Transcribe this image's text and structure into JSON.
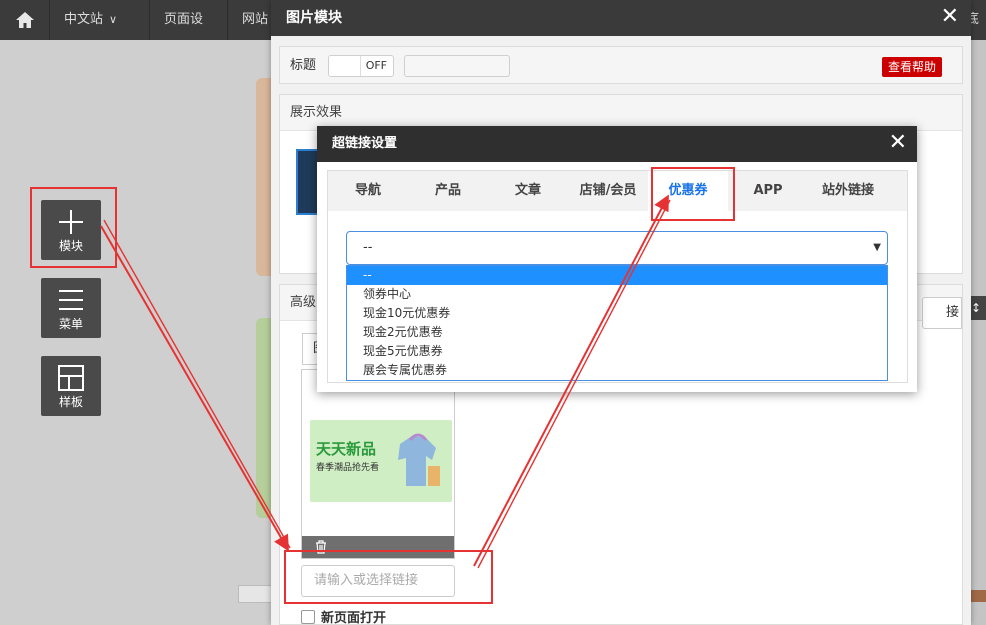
{
  "topbar": {
    "home_icon": "home-icon",
    "nav": [
      {
        "label": "中文站"
      },
      {
        "label": "页面设置"
      },
      {
        "label": "网站"
      }
    ],
    "right_fragment": "底"
  },
  "left_tools": [
    {
      "label": "模块",
      "icon": "plus-icon"
    },
    {
      "label": "菜单",
      "icon": "menu-icon"
    },
    {
      "label": "样板",
      "icon": "template-icon"
    }
  ],
  "picture_dialog": {
    "title": "图片模块",
    "title_row": {
      "label": "标题",
      "toggle_text": "OFF",
      "help_button": "查看帮助"
    },
    "display_section": {
      "label": "展示效果"
    },
    "advanced_section": {
      "label": "高级",
      "tab_stub": "图"
    },
    "promo": {
      "title": "天天新品",
      "subtitle": "春季潮品抢先看"
    },
    "link_input": {
      "placeholder": "请输入或选择链接"
    },
    "new_page_checkbox": "新页面打开",
    "right_button_fragment": "接"
  },
  "link_dialog": {
    "title": "超链接设置",
    "tabs": [
      {
        "label": "导航"
      },
      {
        "label": "产品"
      },
      {
        "label": "文章"
      },
      {
        "label": "店铺/会员"
      },
      {
        "label": "优惠券",
        "active": true
      },
      {
        "label": "APP"
      },
      {
        "label": "站外链接"
      }
    ],
    "select": {
      "value": "--",
      "options": [
        "--",
        "领券中心",
        "现金10元优惠券",
        "现金2元优惠卷",
        "现金5元优惠券",
        "展会专属优惠券"
      ]
    }
  },
  "colors": {
    "accent": "#1a73e8",
    "annotation": "#e53333",
    "help_button": "#cc0000"
  }
}
